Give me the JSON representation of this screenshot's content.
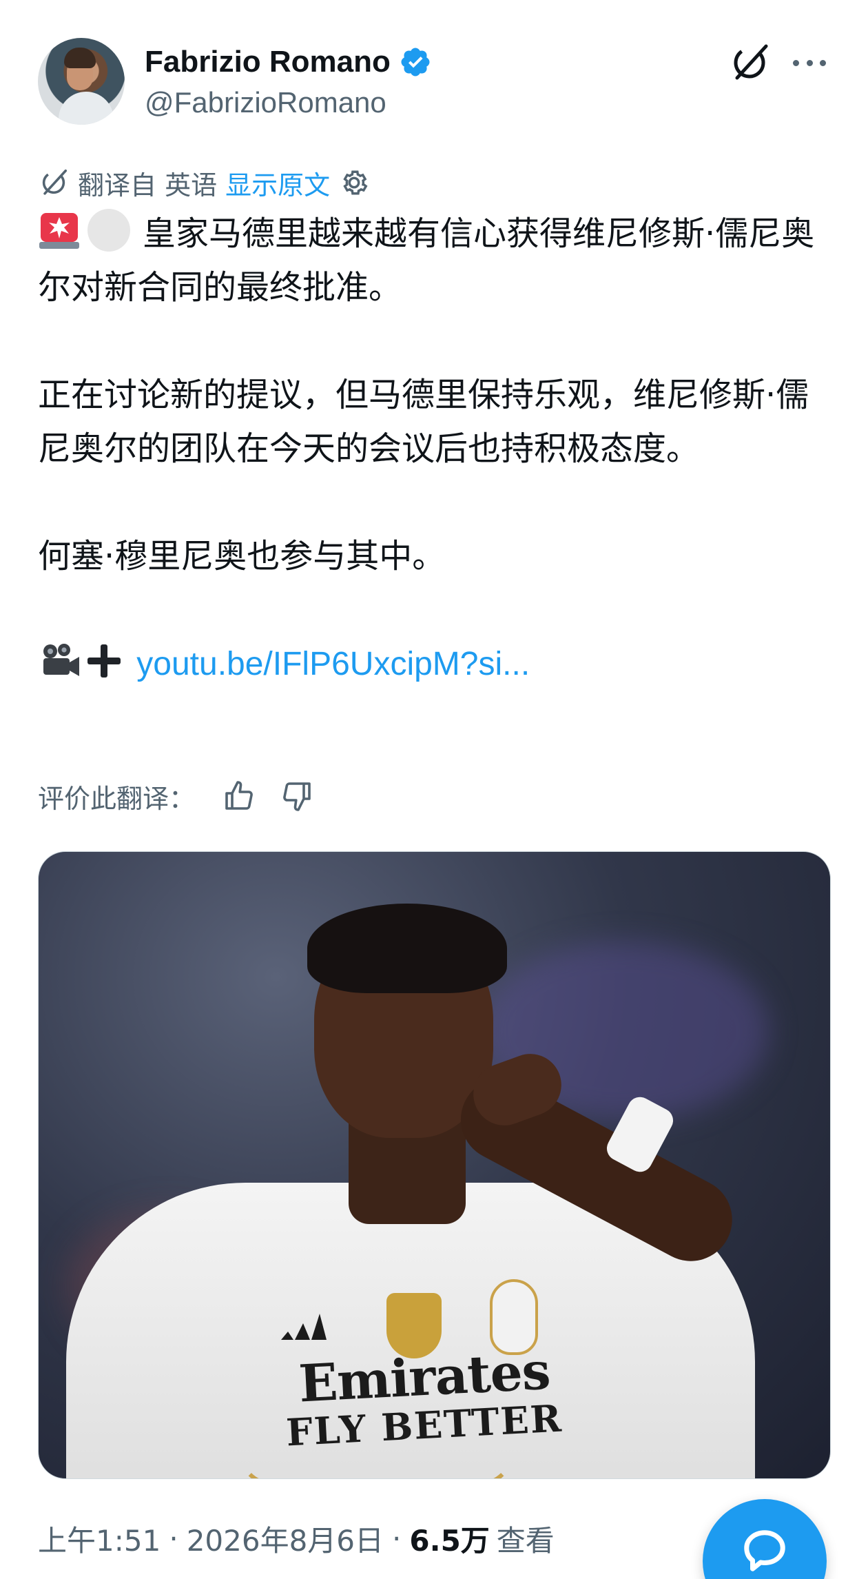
{
  "author": {
    "name": "Fabrizio Romano",
    "handle": "@FabrizioRomano",
    "verified": true
  },
  "translation_bar": {
    "translated_from": "翻译自 英语",
    "show_original": "显示原文"
  },
  "tweet": {
    "line1": "皇家马德里越来越有信心获得维尼修斯·儒尼奥尔对新合同的最终批准。",
    "line2": "正在讨论新的提议，但马德里保持乐观，维尼修斯·儒尼奥尔的团队在今天的会议后也持积极态度。",
    "line3": "何塞·穆里尼奥也参与其中。",
    "link_text": "youtu.be/IFlP6UxcipM?si..."
  },
  "rate": {
    "label": "评价此翻译："
  },
  "media": {
    "sponsor_line1": "Emirates",
    "sponsor_line2": "FLY BETTER"
  },
  "meta": {
    "time": "上午1:51",
    "date": "2026年8月6日",
    "views_count": "6.5万",
    "views_label": "查看"
  },
  "colors": {
    "accent": "#1d9bf0",
    "text_primary": "#0f1419",
    "text_secondary": "#536471"
  },
  "icons": [
    "grok-icon",
    "more-icon",
    "translate-icon",
    "settings-icon",
    "thumbs-up-icon",
    "thumbs-down-icon",
    "verified-badge-icon",
    "compose-reply-icon"
  ]
}
